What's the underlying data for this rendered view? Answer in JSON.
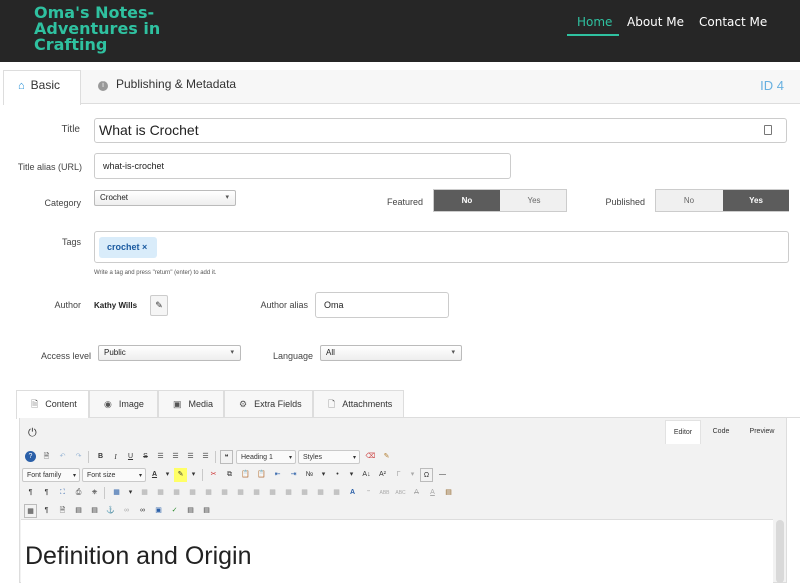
{
  "site": {
    "brand": "Oma's Notes-Adventures in Crafting",
    "nav": [
      "Home",
      "About Me",
      "Contact Me"
    ]
  },
  "tabs": {
    "basic": "Basic",
    "publishing": "Publishing & Metadata",
    "id": "ID 4"
  },
  "form": {
    "title_label": "Title",
    "title_value": "What is Crochet",
    "alias_label": "Title alias (URL)",
    "alias_value": "what-is-crochet",
    "category_label": "Category",
    "category_value": "Crochet",
    "featured_label": "Featured",
    "featured_no": "No",
    "featured_yes": "Yes",
    "published_label": "Published",
    "published_no": "No",
    "published_yes": "Yes",
    "tags_label": "Tags",
    "tag_value": "crochet ×",
    "tags_hint": "Write a tag and press \"return\" (enter) to add it.",
    "author_label": "Author",
    "author_value": "Kathy Wills",
    "author_alias_label": "Author alias",
    "author_alias_value": "Oma",
    "access_label": "Access level",
    "access_value": "Public",
    "language_label": "Language",
    "language_value": "All"
  },
  "content_tabs": [
    "Content",
    "Image",
    "Media",
    "Extra Fields",
    "Attachments"
  ],
  "editor": {
    "modes": [
      "Editor",
      "Code",
      "Preview"
    ],
    "format_value": "Heading 1",
    "styles_value": "Styles",
    "font_family": "Font family",
    "font_size": "Font size",
    "heading": "Definition and Origin"
  },
  "colors": {
    "accent": "#2fc1a0",
    "topbar": "#262626",
    "toggle_active": "#5c5c5c",
    "tag_bg": "#d9ecfa",
    "id_badge": "#67b0e0"
  }
}
